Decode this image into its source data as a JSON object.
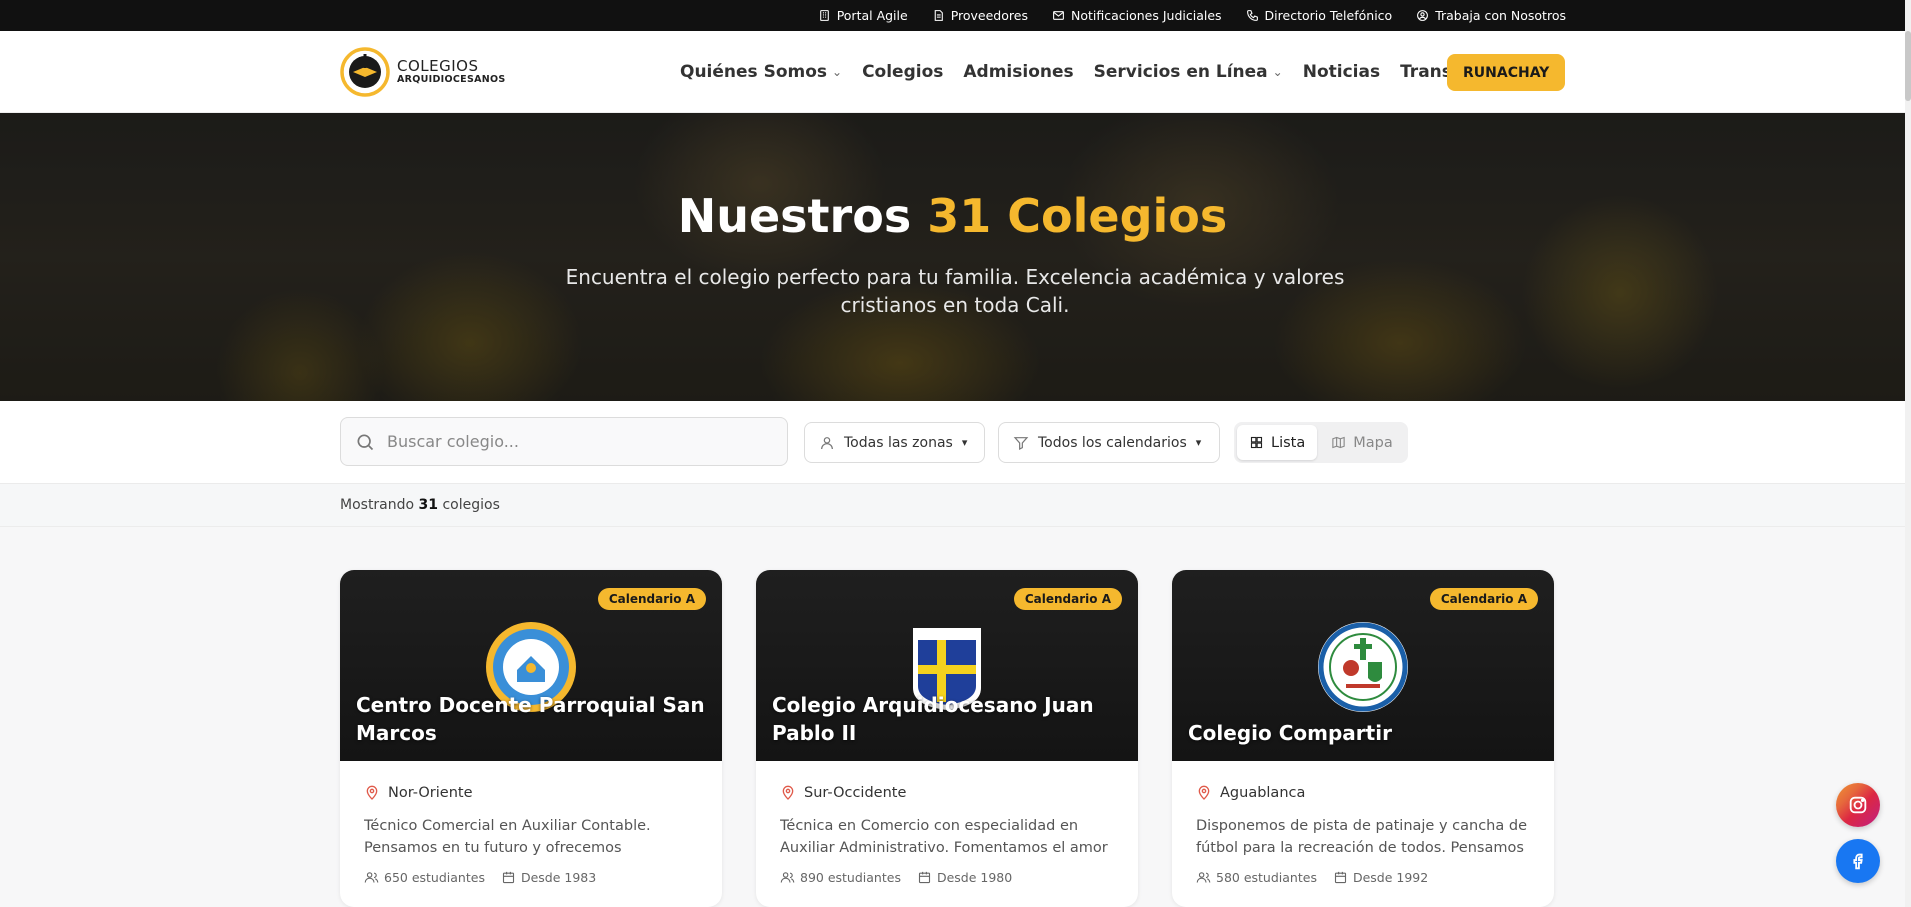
{
  "topbar": {
    "links": [
      {
        "label": "Portal Agile",
        "icon": "building-icon"
      },
      {
        "label": "Proveedores",
        "icon": "document-icon"
      },
      {
        "label": "Notificaciones Judiciales",
        "icon": "mail-icon"
      },
      {
        "label": "Directorio Telefónico",
        "icon": "phone-icon"
      },
      {
        "label": "Trabaja con Nosotros",
        "icon": "user-circle-icon"
      }
    ]
  },
  "brand": {
    "line1": "COLEGIOS",
    "line2": "ARQUIDIOCESANOS"
  },
  "nav": {
    "items": [
      {
        "label": "Quiénes Somos",
        "dropdown": true
      },
      {
        "label": "Colegios",
        "dropdown": false
      },
      {
        "label": "Admisiones",
        "dropdown": false
      },
      {
        "label": "Servicios en Línea",
        "dropdown": true
      },
      {
        "label": "Noticias",
        "dropdown": false
      },
      {
        "label": "Transparencia",
        "dropdown": true
      }
    ],
    "cta_label": "RUNACHAY"
  },
  "hero": {
    "title_prefix": "Nuestros",
    "title_accent": "31 Colegios",
    "subtitle": "Encuentra el colegio perfecto para tu familia. Excelencia académica y valores cristianos en toda Cali."
  },
  "filters": {
    "search_placeholder": "Buscar colegio...",
    "search_value": "",
    "zone_selected": "Todas las zonas",
    "calendar_selected": "Todos los calendarios",
    "view_list_label": "Lista",
    "view_map_label": "Mapa",
    "active_view": "Lista"
  },
  "results": {
    "prefix": "Mostrando",
    "count": "31",
    "suffix": "colegios"
  },
  "cards": [
    {
      "badge": "Calendario A",
      "name": "Centro Docente Parroquial San Marcos",
      "zone": "Nor-Oriente",
      "description": "Técnico Comercial en Auxiliar Contable. Pensamos en tu futuro y ofrecemos formación…",
      "students": "650 estudiantes",
      "since": "Desde 1983"
    },
    {
      "badge": "Calendario A",
      "name": "Colegio Arquidiocesano Juan Pablo II",
      "zone": "Sur-Occidente",
      "description": "Técnica en Comercio con especialidad en Auxiliar Administrativo. Fomentamos el amor p…",
      "students": "890 estudiantes",
      "since": "Desde 1980"
    },
    {
      "badge": "Calendario A",
      "name": "Colegio Compartir",
      "zone": "Aguablanca",
      "description": "Disponemos de pista de patinaje y cancha de fútbol para la recreación de todos. Pensamos …",
      "students": "580 estudiantes",
      "since": "Desde 1992"
    }
  ],
  "colors": {
    "accent": "#f5b82e",
    "topbar": "#111111",
    "instagram": "#dc2743",
    "facebook": "#1877f2"
  }
}
